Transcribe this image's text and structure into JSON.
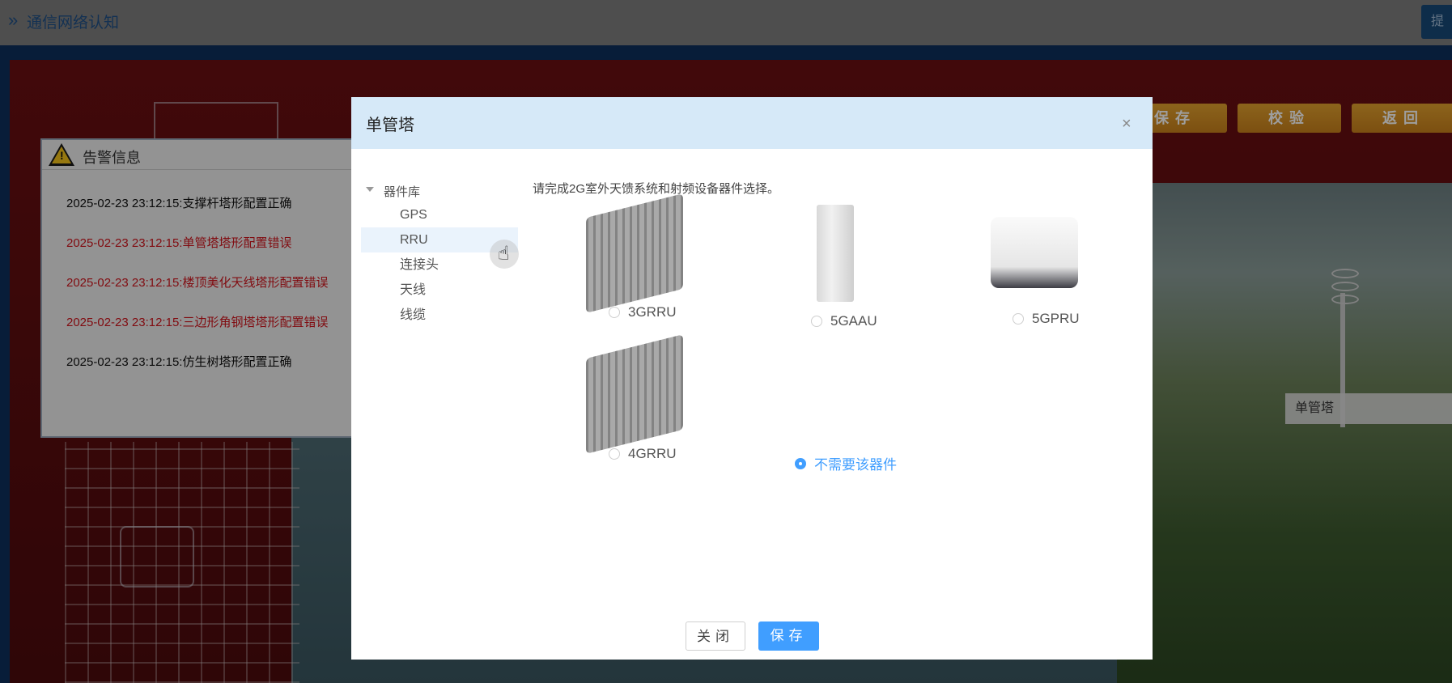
{
  "topbar": {
    "chevron": "»",
    "title": "通信网络认知",
    "submit_label": "提"
  },
  "toolbar": {
    "save_label": "保存",
    "verify_label": "校验",
    "back_label": "返回"
  },
  "scene": {
    "label": "单管塔"
  },
  "warning_panel": {
    "title": "告警信息",
    "icon": "warning-triangle-icon",
    "messages": [
      {
        "text": "2025-02-23 23:12:15:支撑杆塔形配置正确",
        "status": "ok"
      },
      {
        "text": "2025-02-23 23:12:15:单管塔塔形配置错误",
        "status": "error"
      },
      {
        "text": "2025-02-23 23:12:15:楼顶美化天线塔形配置错误",
        "status": "error"
      },
      {
        "text": "2025-02-23 23:12:15:三边形角钢塔塔形配置错误",
        "status": "error"
      },
      {
        "text": "2025-02-23 23:12:15:仿生树塔形配置正确",
        "status": "ok"
      }
    ]
  },
  "dialog": {
    "title": "单管塔",
    "close_symbol": "×",
    "instruction": "请完成2G室外天馈系统和射频设备器件选择。",
    "tree": {
      "root": "器件库",
      "items": [
        "GPS",
        "RRU",
        "连接头",
        "天线",
        "线缆"
      ],
      "selected": "RRU"
    },
    "options": [
      {
        "label": "3GRRU",
        "checked": false,
        "image": "rru-device"
      },
      {
        "label": "5GAAU",
        "checked": false,
        "image": "aau-device"
      },
      {
        "label": "5GPRU",
        "checked": false,
        "image": "pru-device"
      },
      {
        "label": "4GRRU",
        "checked": false,
        "image": "rru-device"
      },
      {
        "label": "不需要该器件",
        "checked": true,
        "image": ""
      }
    ],
    "buttons": {
      "close": "关闭",
      "save": "保存"
    }
  },
  "colors": {
    "primary": "#409eff",
    "error": "#d0141c",
    "header_bg": "#d6e9f8"
  }
}
